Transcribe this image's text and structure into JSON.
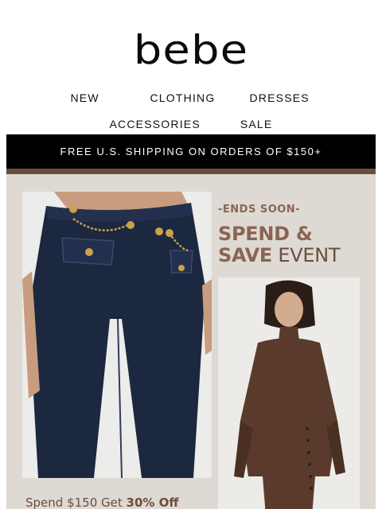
{
  "brand": {
    "logo": "bebe"
  },
  "nav": {
    "row1": [
      "NEW",
      "CLOTHING",
      "DRESSES"
    ],
    "row2": [
      "ACCESSORIES",
      "SALE"
    ]
  },
  "banner": {
    "shipping": "FREE U.S. SHIPPING ON ORDERS OF $150+"
  },
  "hero": {
    "eyebrow": "-ENDS SOON-",
    "headline_line1": "SPEND &",
    "headline_line2_bold": "SAVE",
    "headline_line2_regular": "EVENT",
    "offer_prefix": "Spend $150 Get",
    "offer_bold": "30% Off"
  },
  "colors": {
    "accent": "#8a6553",
    "dark_brown": "#6b4e3d",
    "hero_bg": "#dedad3",
    "bar": "#000000"
  }
}
